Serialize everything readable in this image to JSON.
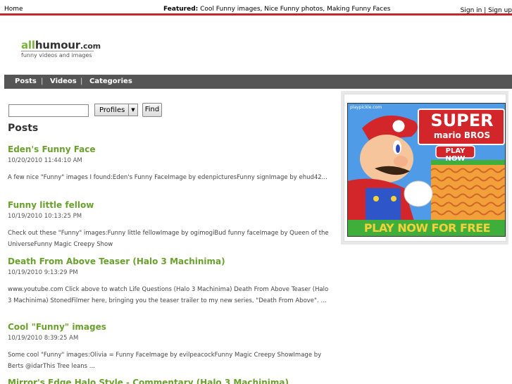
{
  "topbar": {
    "home": "Home",
    "featured_label": "Featured:",
    "featured_links": "Cool Funny images, Nice Funny photos, Making Funny Faces",
    "sign": "Sign in | Sign up"
  },
  "logo": {
    "all": "all",
    "humour": "humour",
    "com": ".com",
    "tagline": "funny videos and images"
  },
  "nav": {
    "posts": "Posts",
    "videos": "Videos",
    "categories": "Categories",
    "sep": "|"
  },
  "search": {
    "value": "",
    "profiles": "Profiles",
    "find": "Find"
  },
  "posts_heading": "Posts",
  "posts": [
    {
      "title": "Eden's Funny Face",
      "date": "10/20/2010 11:44:10 AM",
      "excerpt": "A few nice \"Funny\" images I found:Eden's Funny FaceImage by edenpicturesFunny signImage by ehud42..."
    },
    {
      "title": "Funny little fellow",
      "date": "10/19/2010 10:13:25 PM",
      "excerpt": "Check out these \"Funny\" images:Funny little fellowImage by ogimogiBud funny faceImage by Queen of the UniverseFunny Magic Creepy Show"
    },
    {
      "title": "Death From Above Teaser (Halo 3 Machinima)",
      "date": "10/19/2010 9:13:29 PM",
      "excerpt": "www.youtube.com Click above to watch Life Questions (Halo 3 Machinima) Death From Above Teaser (Halo 3 Machinima) StonedFilmer here, bringing you the teaser trailer to my new series, \"Death From Above\". ..."
    },
    {
      "title": "Cool \"Funny\" images",
      "date": "10/19/2010 8:39:25 AM",
      "excerpt": "Some cool \"Funny\" images:Olivia = Funny FaceImage by evilpeacockFunny Magic Creepy ShowImage by Berts @idarThis Tree leans ..."
    },
    {
      "title": "Mirror's Edge Halo Style - Commentary (Halo 3 Machinima)",
      "date": "",
      "excerpt": ""
    }
  ],
  "ad": {
    "source": "playpickle.com",
    "line1": "SUPER",
    "line2": "mario BROS",
    "button": "PLAY NOW",
    "bottom": "PLAY NOW FOR FREE"
  }
}
